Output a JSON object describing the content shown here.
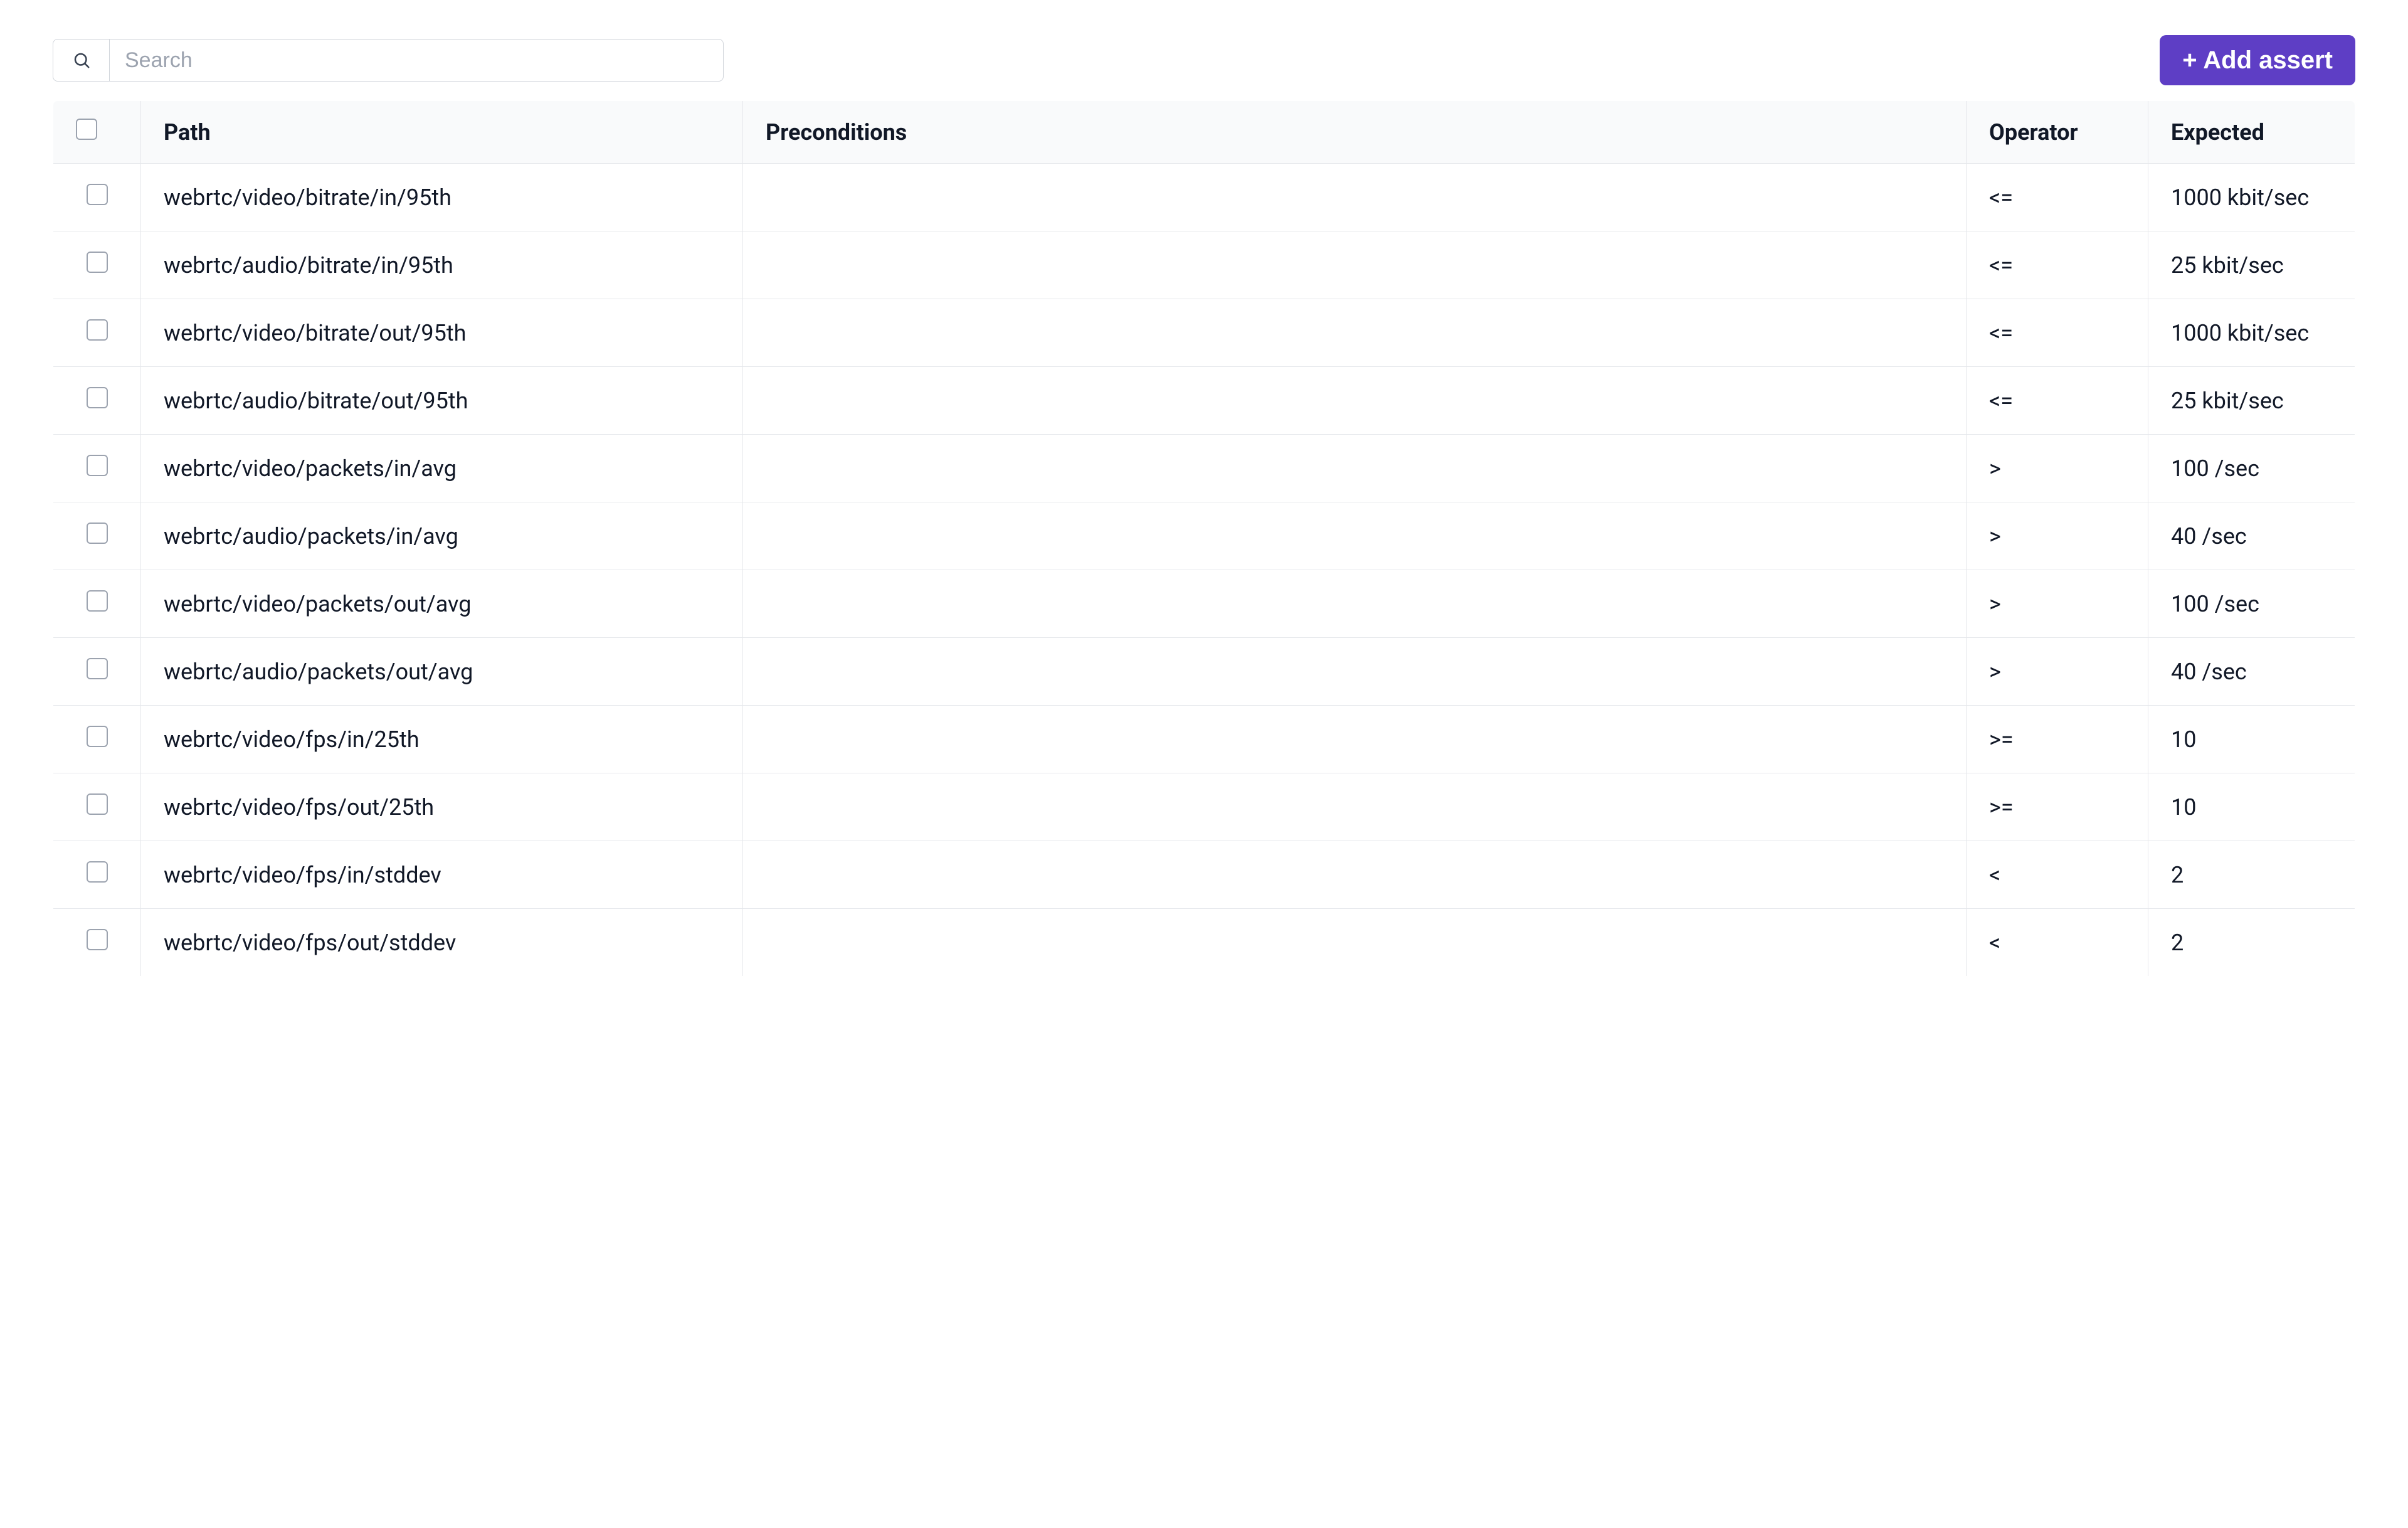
{
  "toolbar": {
    "search_placeholder": "Search",
    "add_button_label": "+ Add assert"
  },
  "table": {
    "columns": {
      "path": "Path",
      "preconditions": "Preconditions",
      "operator": "Operator",
      "expected": "Expected"
    },
    "rows": [
      {
        "path": "webrtc/video/bitrate/in/95th",
        "preconditions": "",
        "operator": "<=",
        "expected": "1000 kbit/sec"
      },
      {
        "path": "webrtc/audio/bitrate/in/95th",
        "preconditions": "",
        "operator": "<=",
        "expected": "25 kbit/sec"
      },
      {
        "path": "webrtc/video/bitrate/out/95th",
        "preconditions": "",
        "operator": "<=",
        "expected": "1000 kbit/sec"
      },
      {
        "path": "webrtc/audio/bitrate/out/95th",
        "preconditions": "",
        "operator": "<=",
        "expected": "25 kbit/sec"
      },
      {
        "path": "webrtc/video/packets/in/avg",
        "preconditions": "",
        "operator": ">",
        "expected": "100 /sec"
      },
      {
        "path": "webrtc/audio/packets/in/avg",
        "preconditions": "",
        "operator": ">",
        "expected": "40 /sec"
      },
      {
        "path": "webrtc/video/packets/out/avg",
        "preconditions": "",
        "operator": ">",
        "expected": "100 /sec"
      },
      {
        "path": "webrtc/audio/packets/out/avg",
        "preconditions": "",
        "operator": ">",
        "expected": "40 /sec"
      },
      {
        "path": "webrtc/video/fps/in/25th",
        "preconditions": "",
        "operator": ">=",
        "expected": "10"
      },
      {
        "path": "webrtc/video/fps/out/25th",
        "preconditions": "",
        "operator": ">=",
        "expected": "10"
      },
      {
        "path": "webrtc/video/fps/in/stddev",
        "preconditions": "",
        "operator": "<",
        "expected": "2"
      },
      {
        "path": "webrtc/video/fps/out/stddev",
        "preconditions": "",
        "operator": "<",
        "expected": "2"
      }
    ]
  }
}
